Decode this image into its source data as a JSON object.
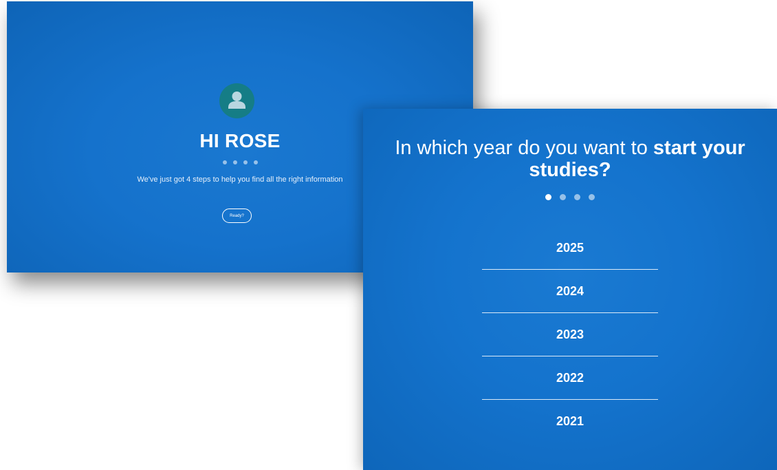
{
  "welcome": {
    "avatar_icon": "user-avatar-icon",
    "title": "HI ROSE",
    "step_dots": 4,
    "description": "We've just got 4 steps to help you find all the right information",
    "ready_button": "Ready?"
  },
  "year_select": {
    "question_prefix": "In which year do you want to ",
    "question_bold": "start your studies?",
    "step_dots": 4,
    "active_step": 1,
    "years": [
      "2025",
      "2024",
      "2023",
      "2022",
      "2021"
    ]
  },
  "colors": {
    "primary_blue": "#1572cc",
    "avatar_teal": "#157d86",
    "text": "#ffffff"
  }
}
